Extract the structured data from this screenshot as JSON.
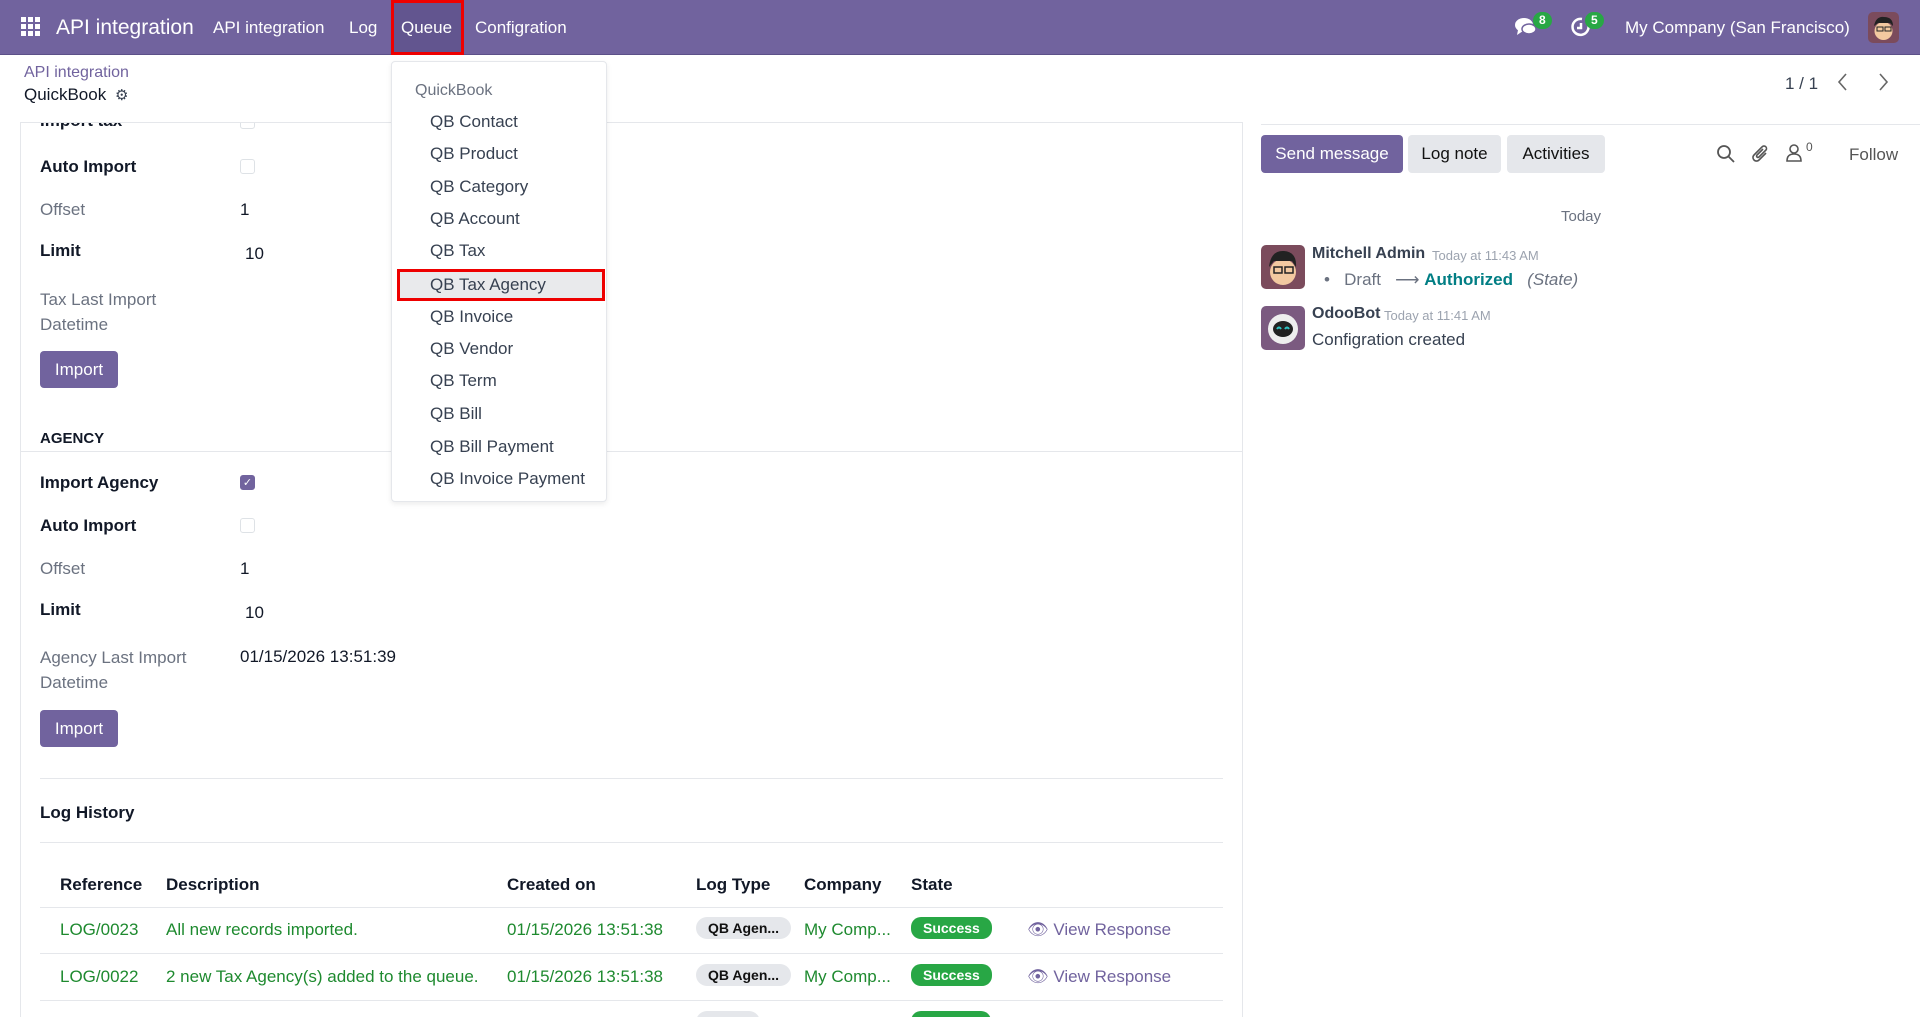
{
  "navbar": {
    "brand": "API integration",
    "items": [
      "API integration",
      "Log",
      "Queue",
      "Configration"
    ],
    "messages_count": "8",
    "activities_count": "5",
    "company": "My Company (San Francisco)"
  },
  "breadcrumb": {
    "parent": "API integration",
    "current": "QuickBook"
  },
  "pager": {
    "text": "1 / 1"
  },
  "queue_menu": {
    "header": "QuickBook",
    "items": [
      "QB Contact",
      "QB Product",
      "QB Category",
      "QB Account",
      "QB Tax",
      "QB Tax Agency",
      "QB Invoice",
      "QB Vendor",
      "QB Term",
      "QB Bill",
      "QB Bill Payment",
      "QB Invoice Payment"
    ],
    "highlighted": "QB Tax Agency"
  },
  "tax_section": {
    "import_label": "Import tax",
    "auto_import_label": "Auto Import",
    "offset_label": "Offset",
    "offset": "1",
    "limit_label": "Limit",
    "limit": "10",
    "last_import_label": "Tax Last Import Datetime",
    "last_import": "",
    "import_button": "Import"
  },
  "agency_section": {
    "title": "AGENCY",
    "import_label": "Import Agency",
    "import_checked": true,
    "auto_import_label": "Auto Import",
    "offset_label": "Offset",
    "offset": "1",
    "limit_label": "Limit",
    "limit": "10",
    "last_import_label": "Agency Last Import Datetime",
    "last_import": "01/15/2026 13:51:39",
    "import_button": "Import"
  },
  "log_history": {
    "title": "Log History",
    "columns": [
      "Reference",
      "Description",
      "Created on",
      "Log Type",
      "Company",
      "State"
    ],
    "rows": [
      {
        "reference": "LOG/0023",
        "description": "All new records imported.",
        "created_on": "01/15/2026 13:51:38",
        "log_type": "QB Agen...",
        "company": "My Comp...",
        "state": "Success",
        "action": "View Response"
      },
      {
        "reference": "LOG/0022",
        "description": "2  new Tax Agency(s) added to the queue.",
        "created_on": "01/15/2026 13:51:38",
        "log_type": "QB Agen...",
        "company": "My Comp...",
        "state": "Success",
        "action": "View Response"
      }
    ]
  },
  "chatter": {
    "send_message": "Send message",
    "log_note": "Log note",
    "activities": "Activities",
    "followers_count": "0",
    "follow": "Follow",
    "date_separator": "Today",
    "messages": [
      {
        "author": "Mitchell Admin",
        "time": "Today at 11:43 AM",
        "old_value": "Draft",
        "new_value": "Authorized",
        "field": "(State)"
      },
      {
        "author": "OdooBot",
        "time": "Today at 11:41 AM",
        "body": "Configration created"
      }
    ]
  },
  "colors": {
    "brand": "#71639e",
    "success": "#28a745",
    "highlight": "#e00000",
    "link": "#017e84"
  }
}
